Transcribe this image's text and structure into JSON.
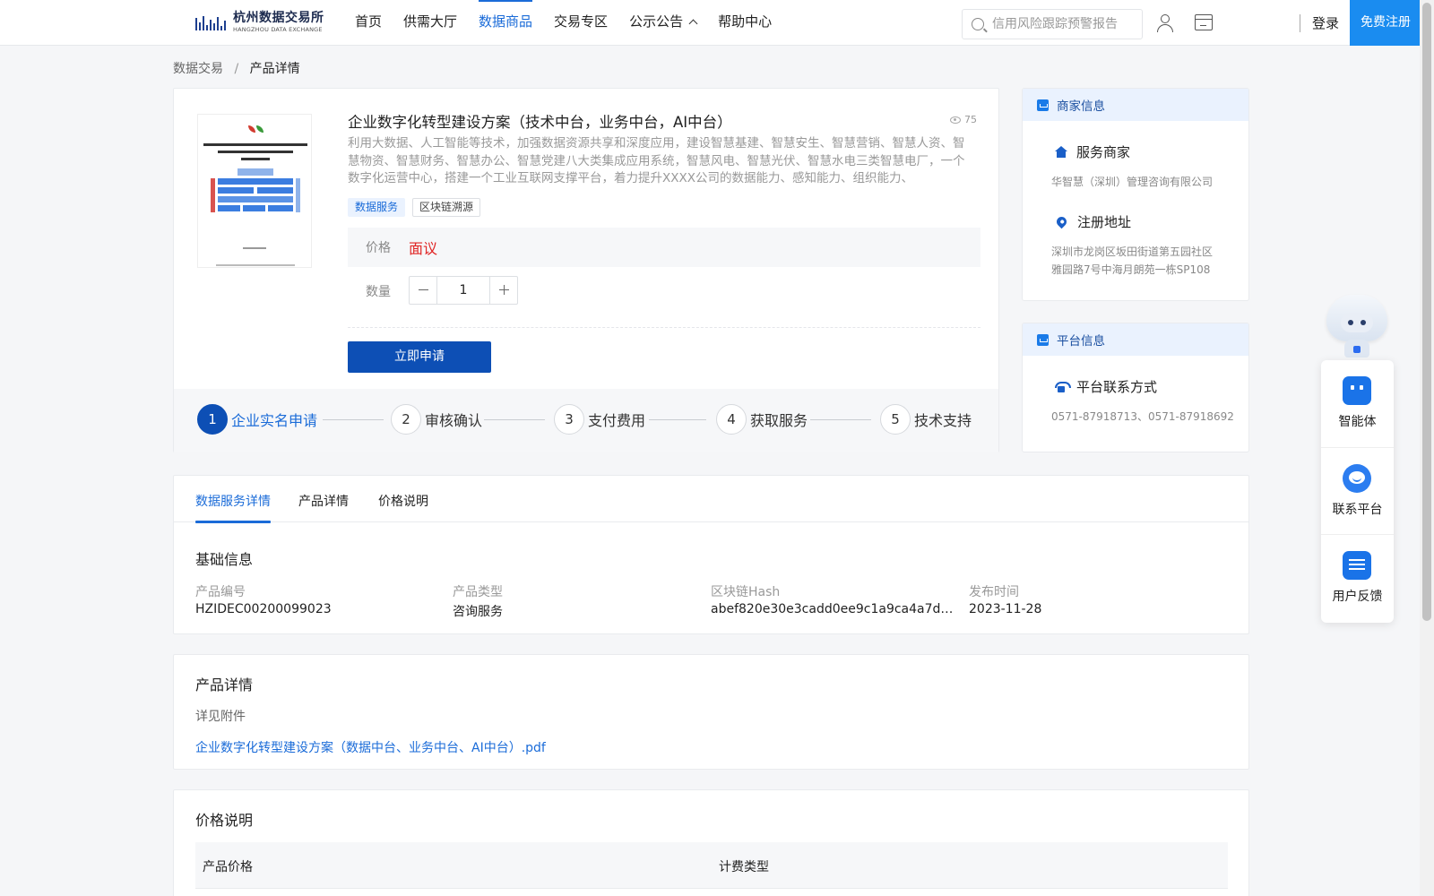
{
  "header": {
    "logo_cn": "杭州数据交易所",
    "logo_en": "HANGZHOU DATA EXCHANGE",
    "nav": [
      {
        "label": "首页"
      },
      {
        "label": "供需大厅"
      },
      {
        "label": "数据商品"
      },
      {
        "label": "交易专区"
      },
      {
        "label": "公示公告"
      },
      {
        "label": "帮助中心"
      }
    ],
    "search_placeholder": "信用风险跟踪预警报告",
    "login": "登录",
    "register": "免费注册",
    "accent_color": "#1a6bd8"
  },
  "breadcrumb": {
    "parent": "数据交易",
    "separator": "/",
    "current": "产品详情"
  },
  "product": {
    "title": "企业数字化转型建设方案（技术中台，业务中台，AI中台）",
    "views": "75",
    "description": "利用大数据、人工智能等技术，加强数据资源共享和深度应用，建设智慧基建、智慧安生、智慧营销、智慧人资、智慧物资、智慧财务、智慧办公、智慧党建八大类集成应用系统，智慧风电、智慧光伏、智慧水电三类智慧电厂，一个数字化运营中心，搭建一个工业互联网支撑平台，着力提升XXXX公司的数据能力、感知能力、组织能力、",
    "tags": [
      "数据服务",
      "区块链溯源"
    ],
    "price_label": "价格",
    "price_value": "面议",
    "price_color": "#e02424",
    "qty_label": "数量",
    "qty_value": "1",
    "apply_button": "立即申请"
  },
  "steps": [
    {
      "num": "1",
      "label": "企业实名申请"
    },
    {
      "num": "2",
      "label": "审核确认"
    },
    {
      "num": "3",
      "label": "支付费用"
    },
    {
      "num": "4",
      "label": "获取服务"
    },
    {
      "num": "5",
      "label": "技术支持"
    }
  ],
  "merchant": {
    "heading": "商家信息",
    "provider_title": "服务商家",
    "provider_name": "华智慧（深圳）管理咨询有限公司",
    "address_title": "注册地址",
    "address_line1": "深圳市龙岗区坂田街道第五园社区",
    "address_line2": "雅园路7号中海月朗苑一栋SP108"
  },
  "platform": {
    "heading": "平台信息",
    "contact_title": "平台联系方式",
    "contact_phones": "0571-87918713、0571-87918692"
  },
  "tabs": [
    {
      "label": "数据服务详情"
    },
    {
      "label": "产品详情"
    },
    {
      "label": "价格说明"
    }
  ],
  "basic_info": {
    "title": "基础信息",
    "fields": [
      {
        "label": "产品编号",
        "value": "HZIDEC00200099023"
      },
      {
        "label": "产品类型",
        "value": "咨询服务"
      },
      {
        "label": "区块链Hash",
        "value": "abef820e30e3cadd0ee9c1a9ca4a7d1e90..."
      },
      {
        "label": "发布时间",
        "value": "2023-11-28"
      }
    ]
  },
  "product_detail": {
    "title": "产品详情",
    "note": "详见附件",
    "attachment": "企业数字化转型建设方案（数据中台、业务中台、AI中台）.pdf"
  },
  "price_desc": {
    "title": "价格说明",
    "columns": [
      "产品价格",
      "计费类型"
    ]
  },
  "float_widget": {
    "items": [
      {
        "label": "智能体",
        "icon": "agent-icon"
      },
      {
        "label": "联系平台",
        "icon": "headset-icon"
      },
      {
        "label": "用户反馈",
        "icon": "feedback-icon"
      }
    ]
  }
}
